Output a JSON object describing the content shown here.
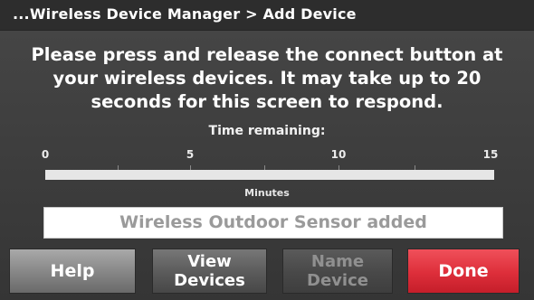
{
  "header": {
    "title": "...Wireless Device Manager > Add Device"
  },
  "message": {
    "lines": [
      "Please press and release the connect button at",
      "your wireless devices. It may take up to 20",
      "seconds for this screen to respond."
    ]
  },
  "timer": {
    "label": "Time remaining:",
    "scale_labels": [
      "0",
      "5",
      "10",
      "15"
    ],
    "scale_min": 0,
    "scale_max": 15,
    "remaining_minutes": 15,
    "unit_label": "Minutes"
  },
  "status": {
    "text": "Wireless Outdoor Sensor added"
  },
  "buttons": {
    "help": "Help",
    "view_devices": "View\nDevices",
    "name_device": "Name\nDevice",
    "done": "Done"
  },
  "colors": {
    "done_button": "#dd2e3a",
    "screen_background": "#3f3f3f",
    "title_bar": "#2d2d2d",
    "disabled_text": "#909090"
  }
}
